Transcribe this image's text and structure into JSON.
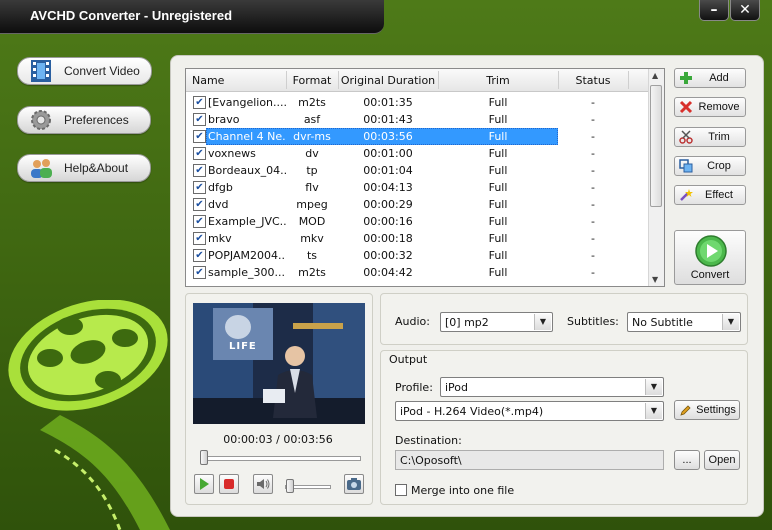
{
  "window": {
    "title": "AVCHD Converter - Unregistered",
    "minimize": "–",
    "close": "✕"
  },
  "nav": [
    {
      "label": "Convert Video"
    },
    {
      "label": "Preferences"
    },
    {
      "label": "Help&About"
    }
  ],
  "list": {
    "columns": {
      "name": "Name",
      "format": "Format",
      "duration": "Original Duration",
      "trim": "Trim",
      "status": "Status"
    },
    "rows": [
      {
        "name": "[Evangelion....",
        "format": "m2ts",
        "duration": "00:01:35",
        "trim": "Full",
        "status": "-"
      },
      {
        "name": "bravo",
        "format": "asf",
        "duration": "00:01:43",
        "trim": "Full",
        "status": "-"
      },
      {
        "name": "Channel 4 Ne...",
        "format": "dvr-ms",
        "duration": "00:03:56",
        "trim": "Full",
        "status": "-"
      },
      {
        "name": "voxnews",
        "format": "dv",
        "duration": "00:01:00",
        "trim": "Full",
        "status": "-"
      },
      {
        "name": "Bordeaux_04...",
        "format": "tp",
        "duration": "00:01:04",
        "trim": "Full",
        "status": "-"
      },
      {
        "name": "dfgb",
        "format": "flv",
        "duration": "00:04:13",
        "trim": "Full",
        "status": "-"
      },
      {
        "name": "dvd",
        "format": "mpeg",
        "duration": "00:00:29",
        "trim": "Full",
        "status": "-"
      },
      {
        "name": "Example_JVC...",
        "format": "MOD",
        "duration": "00:00:16",
        "trim": "Full",
        "status": "-"
      },
      {
        "name": "mkv",
        "format": "mkv",
        "duration": "00:00:18",
        "trim": "Full",
        "status": "-"
      },
      {
        "name": "POPJAM2004...",
        "format": "ts",
        "duration": "00:00:32",
        "trim": "Full",
        "status": "-"
      },
      {
        "name": "sample_300...",
        "format": "m2ts",
        "duration": "00:04:42",
        "trim": "Full",
        "status": "-"
      }
    ],
    "selected_index": 2,
    "check_mark": "✔"
  },
  "side_buttons": {
    "add": "Add",
    "remove": "Remove",
    "trim": "Trim",
    "crop": "Crop",
    "effect": "Effect",
    "convert": "Convert"
  },
  "preview": {
    "timecode": "00:00:03 / 00:03:56",
    "screen_text": "LIFE"
  },
  "settings": {
    "audio_label": "Audio:",
    "audio_value": "[0] mp2",
    "subtitles_label": "Subtitles:",
    "subtitles_value": "No Subtitle"
  },
  "output": {
    "group_label": "Output",
    "profile_label": "Profile:",
    "profile_value": "iPod",
    "format_value": "iPod - H.264 Video(*.mp4)",
    "settings_button": "Settings",
    "destination_label": "Destination:",
    "destination_value": "C:\\Oposoft\\",
    "browse_button": "...",
    "open_button": "Open",
    "merge_label": "Merge into one file"
  },
  "colors": {
    "background": "#3d6410",
    "selection": "#3399ff",
    "accent": "#8fd12a"
  }
}
